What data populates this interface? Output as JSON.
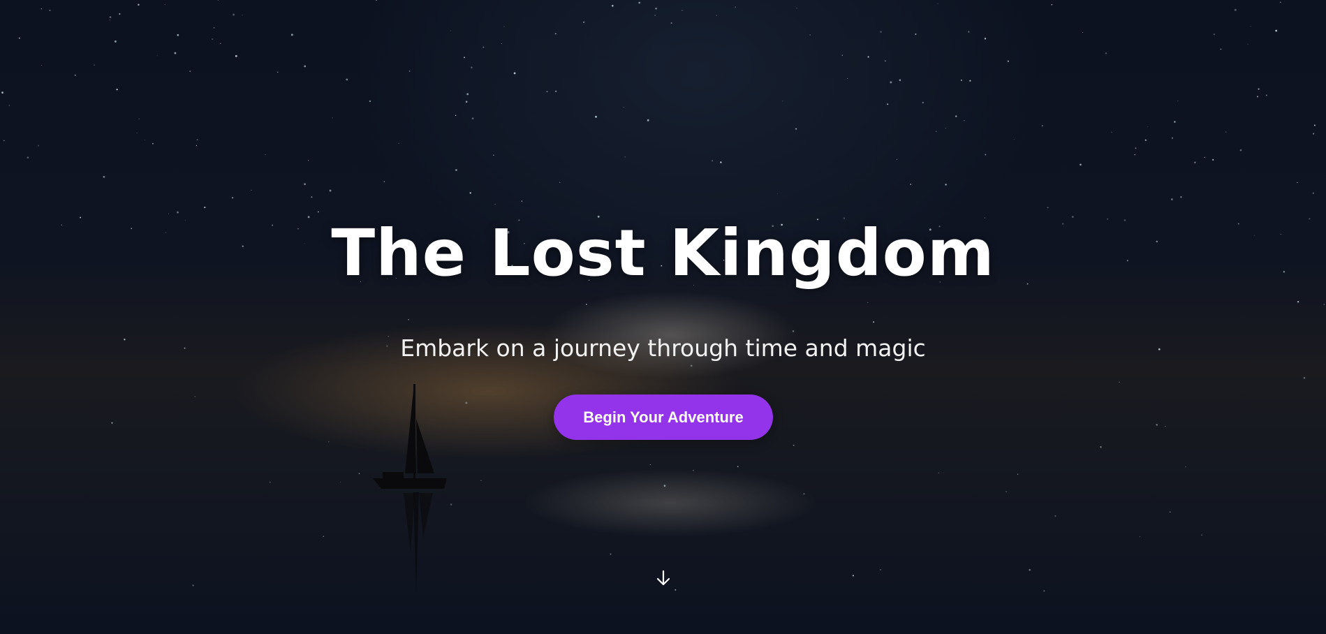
{
  "hero": {
    "title": "The Lost Kingdom",
    "subtitle": "Embark on a journey through time and magic",
    "cta_label": "Begin Your Adventure",
    "scroll_icon": "arrow-down-icon"
  },
  "colors": {
    "accent": "#9333ea",
    "text": "#ffffff",
    "background": "#0c1220"
  }
}
